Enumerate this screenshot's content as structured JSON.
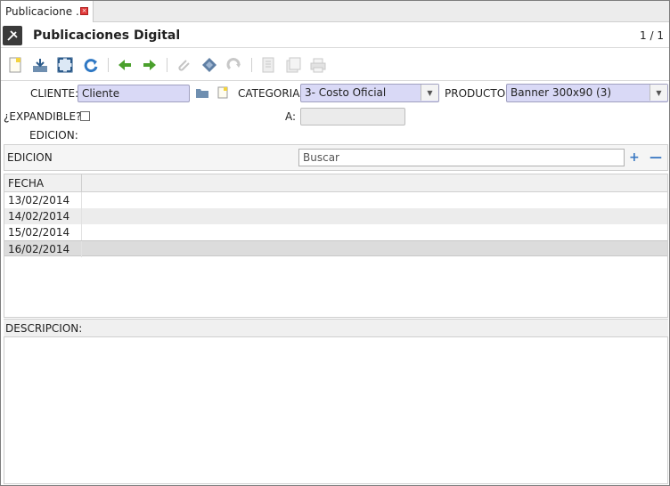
{
  "tab": {
    "label": "Publicacione ..."
  },
  "header": {
    "title": "Publicaciones Digital",
    "pager": "1 / 1"
  },
  "toolbar": {
    "icons": [
      "new-icon",
      "save-icon",
      "fullscreen-icon",
      "refresh-icon",
      "previous-icon",
      "next-icon",
      "attach-icon",
      "zoom-icon",
      "redo-icon",
      "report-icon",
      "archive-icon",
      "print-icon"
    ]
  },
  "form": {
    "cliente_label": "CLIENTE:",
    "cliente_value": "Cliente",
    "categoria_label": "CATEGORIA:",
    "categoria_value": "3- Costo Oficial",
    "producto_label": "PRODUCTO:",
    "producto_value": "Banner 300x90 (3)",
    "expandible_label": "¿EXPANDIBLE?",
    "a_label": "A:",
    "edicion_label": "EDICION:"
  },
  "edicion_panel": {
    "label": "EDICION",
    "search_placeholder": "Buscar",
    "add": "+",
    "remove": "—"
  },
  "grid": {
    "header": "FECHA",
    "rows": [
      "13/02/2014",
      "14/02/2014",
      "15/02/2014",
      "16/02/2014"
    ]
  },
  "descripcion": {
    "label": "DESCRIPCION:"
  },
  "colors": {
    "field_bg": "#d9d9f6",
    "accent_blue": "#3a78c2",
    "green_arrow": "#4aa02c"
  }
}
